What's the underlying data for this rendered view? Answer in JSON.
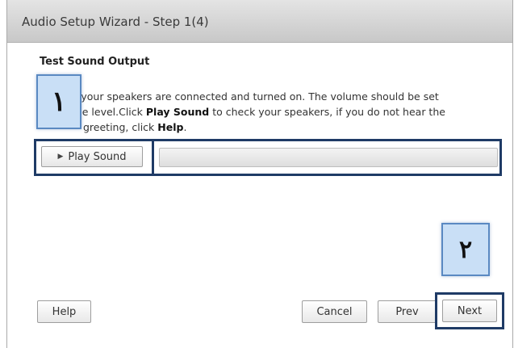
{
  "window": {
    "title": "Audio Setup Wizard - Step 1(4)"
  },
  "section": {
    "heading": "Test Sound Output",
    "text_1": "that your speakers are connected and turned on. The volume should be set",
    "text_2a": "udible level.Click",
    "text_2_bold": "Play Sound",
    "text_2b": "to check your speakers, if you do not hear the",
    "text_3a": "greeting, click",
    "text_3_bold": "Help",
    "text_3b": "."
  },
  "play_sound": {
    "label": "Play Sound",
    "icon": "play-icon"
  },
  "annotations": {
    "badge_1": "١",
    "badge_2": "٢"
  },
  "footer": {
    "help_label": "Help",
    "cancel_label": "Cancel",
    "prev_label": "Prev",
    "next_label": "Next"
  },
  "colors": {
    "highlight_border": "#1f3b66",
    "badge_fill": "#c9dff6",
    "titlebar": "#d6d6d6"
  }
}
